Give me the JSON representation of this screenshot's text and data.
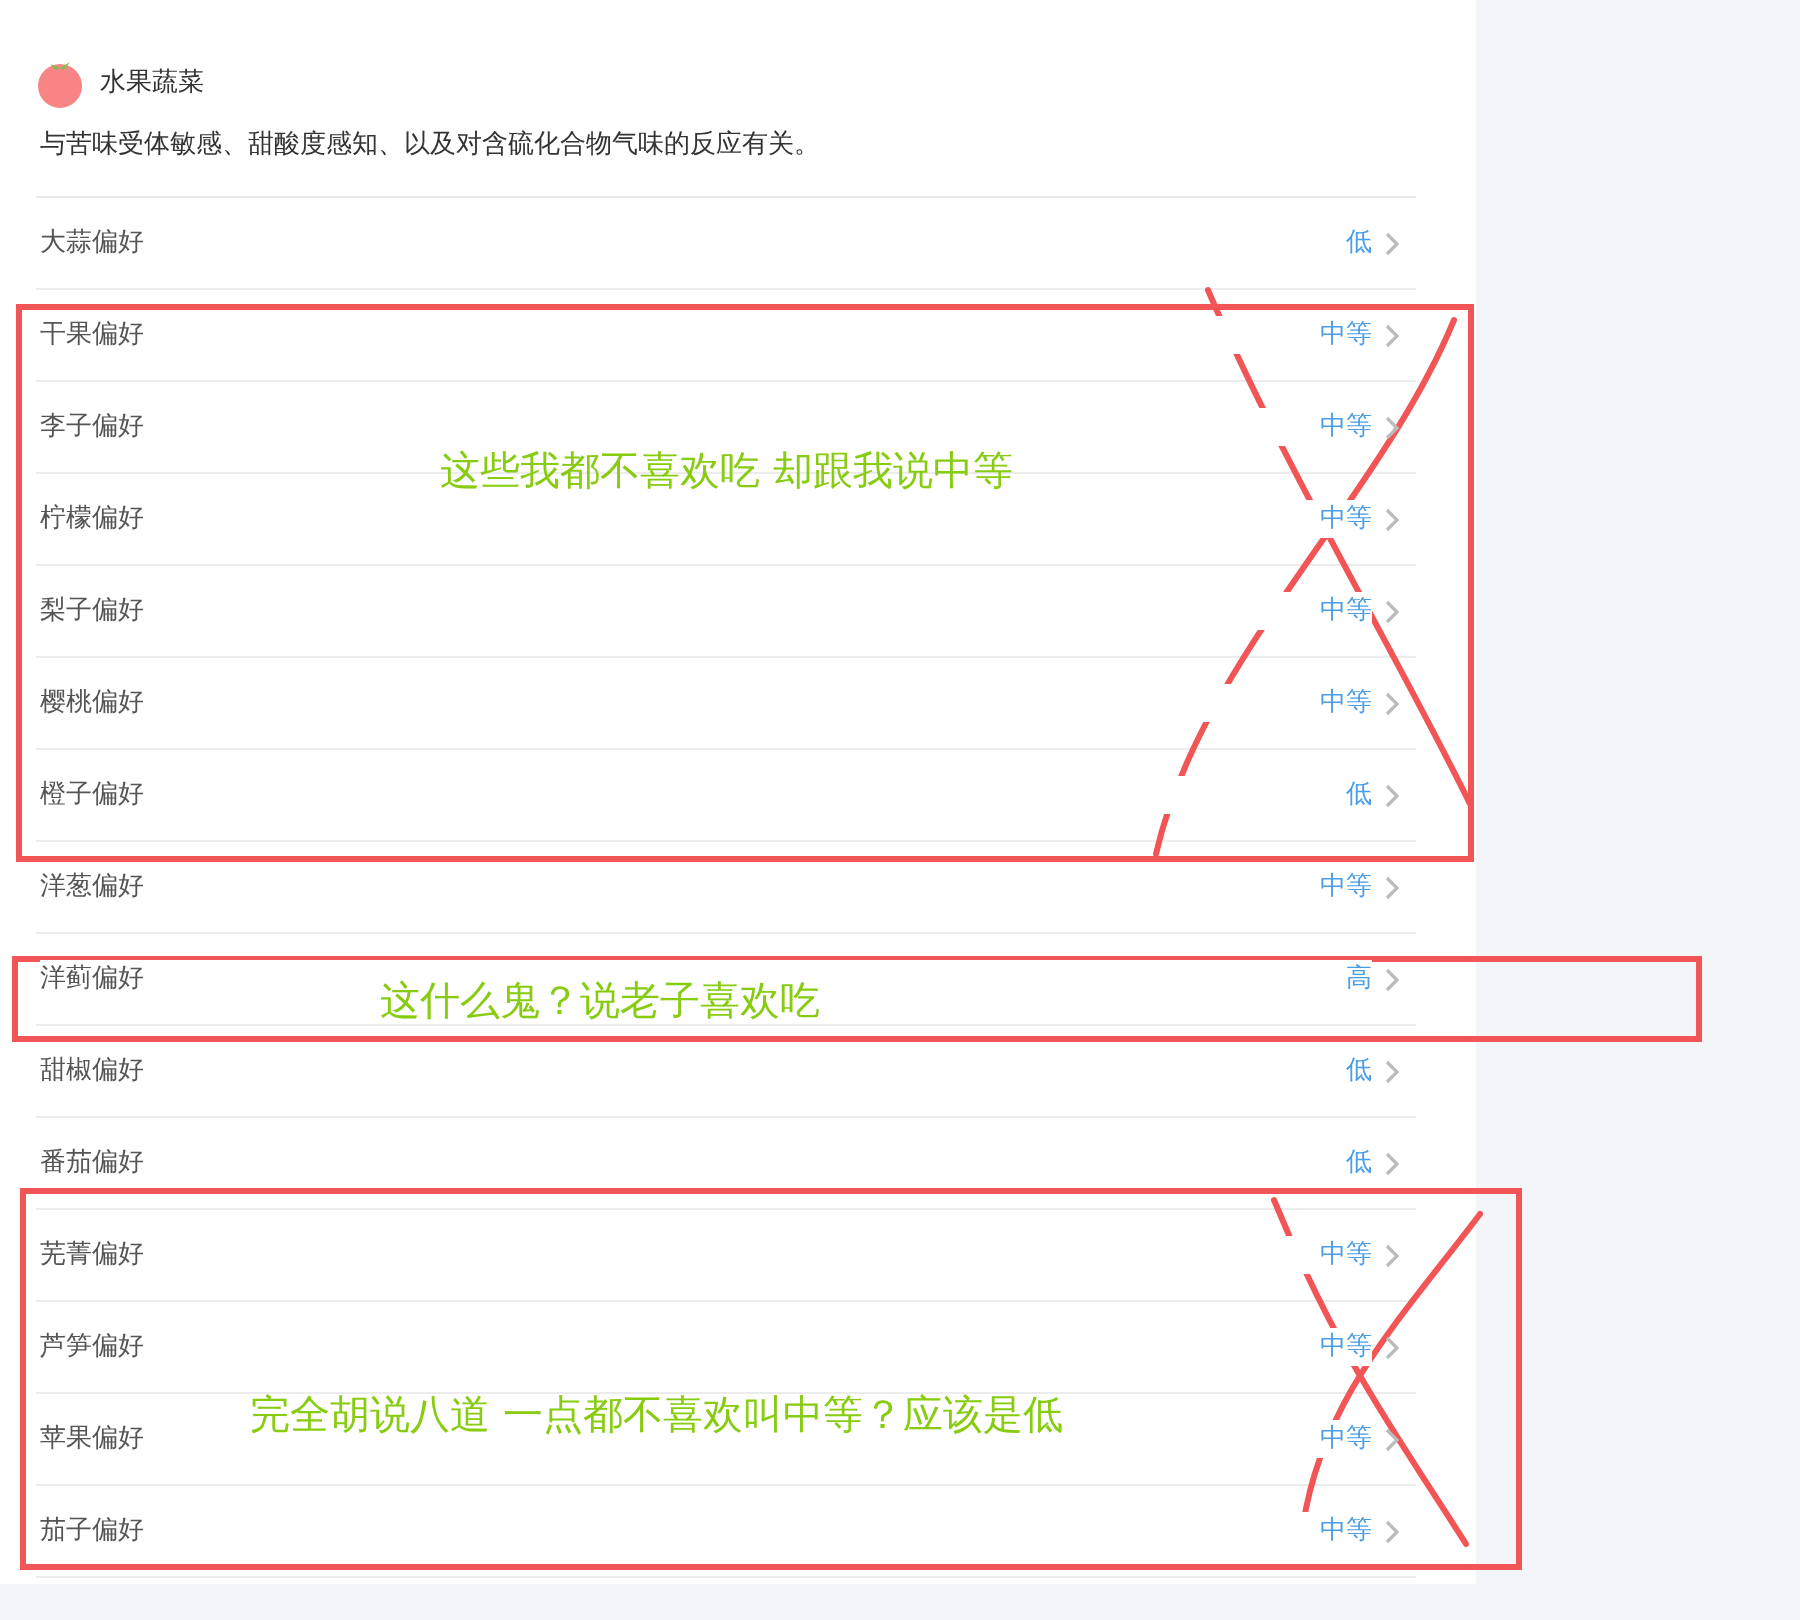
{
  "category": {
    "title": "水果蔬菜",
    "description": "与苦味受体敏感、甜酸度感知、以及对含硫化合物气味的反应有关。"
  },
  "preferences": [
    {
      "label": "大蒜偏好",
      "value": "低"
    },
    {
      "label": "干果偏好",
      "value": "中等"
    },
    {
      "label": "李子偏好",
      "value": "中等"
    },
    {
      "label": "柠檬偏好",
      "value": "中等"
    },
    {
      "label": "梨子偏好",
      "value": "中等"
    },
    {
      "label": "樱桃偏好",
      "value": "中等"
    },
    {
      "label": "橙子偏好",
      "value": "低"
    },
    {
      "label": "洋葱偏好",
      "value": "中等"
    },
    {
      "label": "洋蓟偏好",
      "value": "高"
    },
    {
      "label": "甜椒偏好",
      "value": "低"
    },
    {
      "label": "番茄偏好",
      "value": "低"
    },
    {
      "label": "芜菁偏好",
      "value": "中等"
    },
    {
      "label": "芦笋偏好",
      "value": "中等"
    },
    {
      "label": "苹果偏好",
      "value": "中等"
    },
    {
      "label": "茄子偏好",
      "value": "中等"
    }
  ],
  "annotations": [
    {
      "note": "这些我都不喜欢吃 却跟我说中等",
      "crossed": true
    },
    {
      "note": "这什么鬼？说老子喜欢吃",
      "crossed": false
    },
    {
      "note": "完全胡说八道 一点都不喜欢叫中等？应该是低",
      "crossed": true
    }
  ]
}
